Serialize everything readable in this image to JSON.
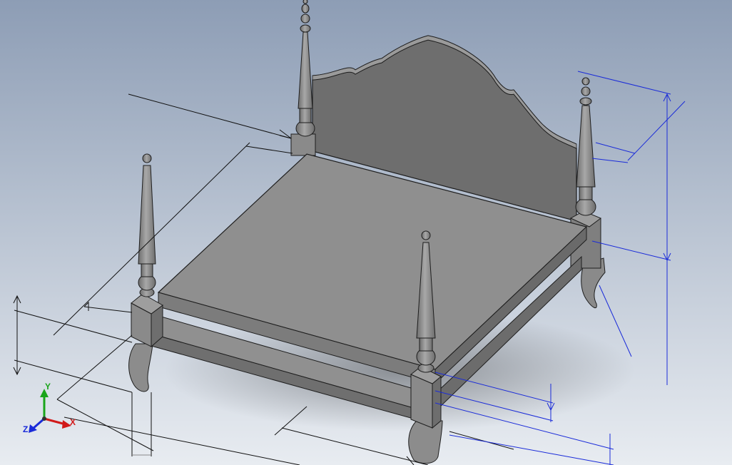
{
  "viewport": {
    "background_top": "#8d9db5",
    "background_bottom": "#e8ecf1",
    "model_name": ""
  },
  "colors": {
    "part_fill": "#8e8e8e",
    "part_dark": "#6a6a6a",
    "part_light": "#a5a5a5",
    "edge": "#1e1e1e",
    "dimension_black": "#111111",
    "dimension_blue": "#1a2bd9"
  },
  "triad": {
    "x_label": "X",
    "y_label": "Y",
    "z_label": "Z",
    "x_color": "#d11a1a",
    "y_color": "#1aa51a",
    "z_color": "#1a2bd9",
    "icon": "coordinate-triad-icon"
  }
}
